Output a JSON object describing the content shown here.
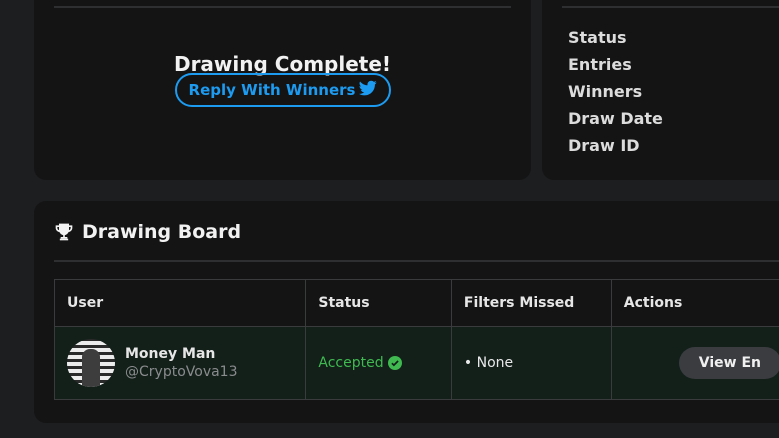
{
  "drawing": {
    "complete_title": "Drawing Complete!",
    "reply_button": "Reply With Winners",
    "reply_icon": "twitter-bird-icon"
  },
  "stats": {
    "labels": [
      "Status",
      "Entries",
      "Winners",
      "Draw Date",
      "Draw ID"
    ]
  },
  "board": {
    "title": "Drawing Board",
    "icon": "trophy-icon",
    "columns": [
      "User",
      "Status",
      "Filters Missed",
      "Actions"
    ],
    "rows": [
      {
        "user_name": "Money Man",
        "user_handle": "@CryptoVova13",
        "status": "Accepted",
        "filters_missed": "• None",
        "action": "View En"
      }
    ]
  },
  "colors": {
    "accent_blue": "#1d9bf0",
    "accepted_green": "#3fb950"
  }
}
